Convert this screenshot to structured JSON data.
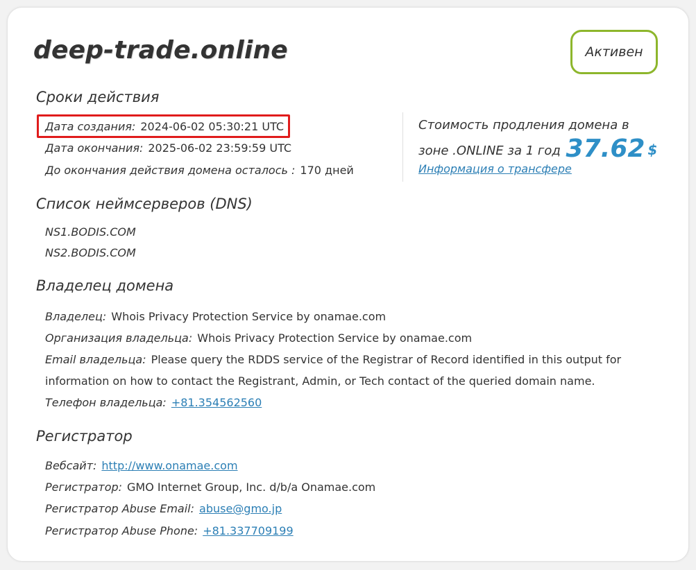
{
  "domain": "deep-trade.online",
  "status": "Активен",
  "colors": {
    "accent_green": "#8db62c",
    "link_blue": "#2c7fb5",
    "price_blue": "#2e8fc7",
    "highlight_red": "#e01c1c"
  },
  "validity": {
    "title": "Сроки действия",
    "created_label": "Дата создания:",
    "created_value": "2024-06-02 05:30:21 UTC",
    "expires_label": "Дата окончания:",
    "expires_value": "2025-06-02 23:59:59 UTC",
    "remaining_label": "До окончания действия домена осталось :",
    "remaining_value": "170 дней"
  },
  "renewal": {
    "text_line1": "Стоимость продления домена в",
    "text_line2": "зоне .ONLINE за 1 год",
    "price": "37.62",
    "currency": "$",
    "transfer_link": "Информация о трансфере"
  },
  "nameservers": {
    "title": "Список неймсерверов (DNS)",
    "items": [
      "NS1.BODIS.COM",
      "NS2.BODIS.COM"
    ]
  },
  "owner": {
    "title": "Владелец домена",
    "owner_label": "Владелец:",
    "owner_value": "Whois Privacy Protection Service by onamae.com",
    "org_label": "Организация владельца:",
    "org_value": "Whois Privacy Protection Service by onamae.com",
    "email_label": "Email владельца:",
    "email_value_line1": "Please query the RDDS service of the Registrar of Record identified in this output for",
    "email_value_line2": "information on how to contact the Registrant, Admin, or Tech contact of the queried domain name.",
    "phone_label": "Телефон владельца:",
    "phone_value": "+81.354562560"
  },
  "registrar": {
    "title": "Регистратор",
    "website_label": "Вебсайт:",
    "website_value": "http://www.onamae.com",
    "registrar_label": "Регистратор:",
    "registrar_value": "GMO Internet Group, Inc. d/b/a Onamae.com",
    "abuse_email_label": "Регистратор Abuse Email:",
    "abuse_email_value": "abuse@gmo.jp",
    "abuse_phone_label": "Регистратор Abuse Phone:",
    "abuse_phone_value": "+81.337709199"
  }
}
